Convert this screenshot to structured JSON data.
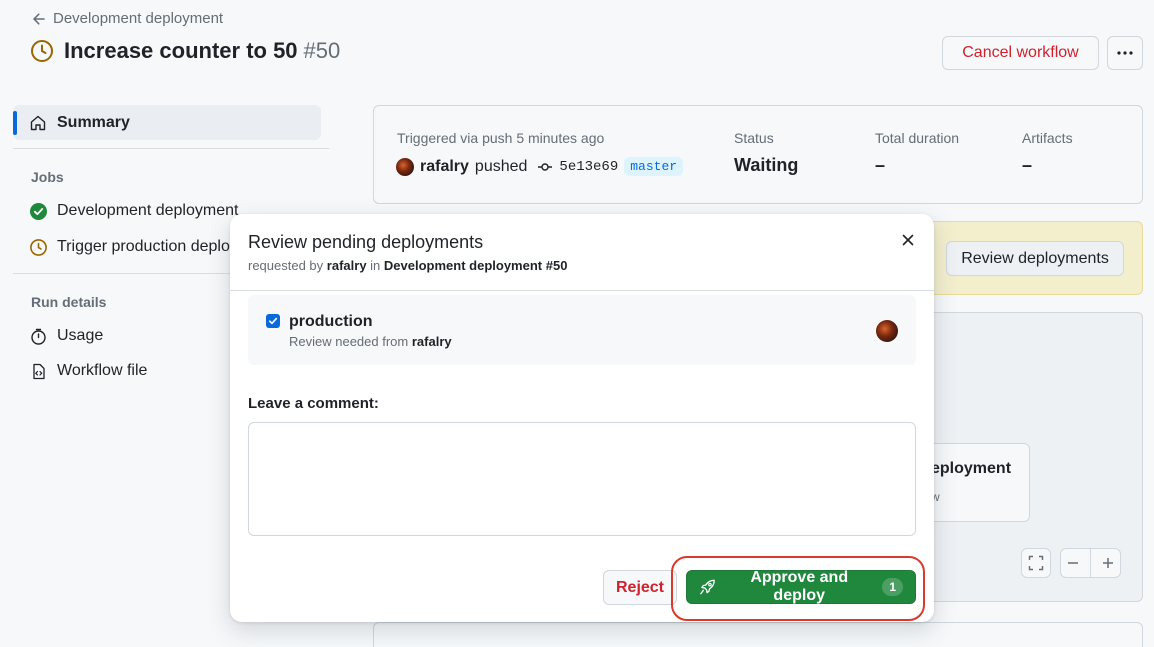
{
  "header": {
    "back_label": "Development deployment",
    "title": "Increase counter to 50",
    "run_number": "#50",
    "cancel_label": "Cancel workflow",
    "status_icon": "clock-icon"
  },
  "sidebar": {
    "summary_label": "Summary",
    "jobs_heading": "Jobs",
    "jobs": [
      {
        "label": "Development deployment",
        "status": "success"
      },
      {
        "label": "Trigger production deplo",
        "status": "waiting"
      }
    ],
    "run_details_heading": "Run details",
    "run_details": [
      {
        "label": "Usage",
        "icon": "stopwatch-icon"
      },
      {
        "label": "Workflow file",
        "icon": "file-code-icon"
      }
    ]
  },
  "summary_card": {
    "trigger_text": "Triggered via push 5 minutes ago",
    "actor": "rafalry",
    "action": "pushed",
    "commit_sha": "5e13e69",
    "branch": "master",
    "status_label": "Status",
    "status_value": "Waiting",
    "duration_label": "Total duration",
    "duration_value": "–",
    "artifacts_label": "Artifacts",
    "artifacts_value": "–"
  },
  "banner": {
    "review_button_label": "Review deployments"
  },
  "graph": {
    "node_title_partial": "eployment",
    "node_sub_partial": "w"
  },
  "modal": {
    "title": "Review pending deployments",
    "sub_prefix": "requested by",
    "sub_actor": "rafalry",
    "sub_in": "in",
    "sub_run": "Development deployment #50",
    "environment": {
      "name": "production",
      "checked": true,
      "review_prefix": "Review needed from",
      "reviewer": "rafalry"
    },
    "comment_label": "Leave a comment:",
    "comment_value": "",
    "reject_label": "Reject",
    "approve_label": "Approve and deploy",
    "approve_count": "1"
  },
  "colors": {
    "accent": "#0969da",
    "danger": "#cf222e",
    "success": "#1f883d",
    "waiting": "#9a6700",
    "highlight": "#d93a2b"
  }
}
